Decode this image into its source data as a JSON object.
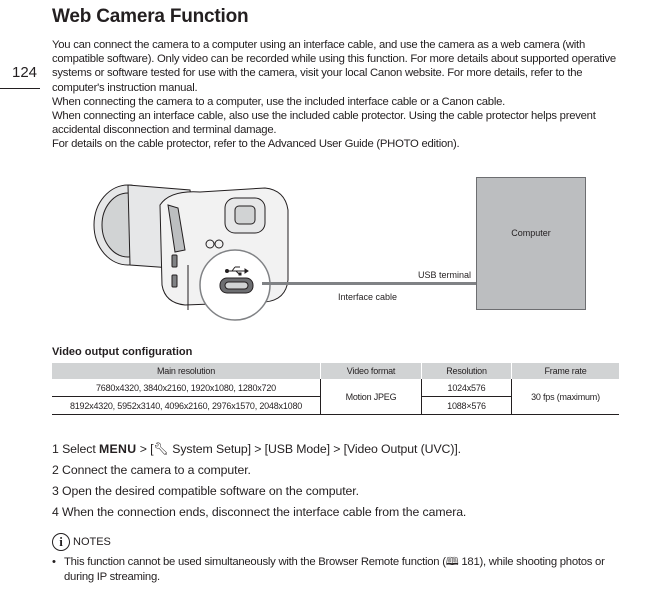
{
  "page": {
    "title": "Web Camera Function",
    "page_number": "124",
    "intro_paragraphs": [
      "You can connect the camera to a computer using an interface cable, and use the camera as a web camera (with compatible software). Only video can be recorded while using this function. For more details about supported operative systems or software tested for use with the camera, visit your local Canon website. For more details, refer to the computer's instruction manual.",
      "When connecting the camera to a computer, use the included interface cable or a Canon cable.",
      "When connecting an interface cable, also use the included cable protector. Using the cable protector helps prevent accidental disconnection and terminal damage.",
      "For details on the cable protector, refer to the Advanced User Guide (PHOTO edition)."
    ]
  },
  "figure": {
    "computer_label": "Computer",
    "usb_terminal_label": "USB terminal",
    "cable_label": "Interface cable",
    "usb_symbol": "usb-icon"
  },
  "table": {
    "title": "Video output configuration",
    "headers": [
      "Main resolution",
      "Video format",
      "Resolution",
      "Frame rate"
    ],
    "rows": [
      {
        "main_resolution": "7680x4320, 3840x2160, 1920x1080, 1280x720",
        "resolution": "1024x576"
      },
      {
        "main_resolution": "8192x4320, 5952x3140, 4096x2160, 2976x1570, 2048x1080",
        "resolution": "1088×576"
      }
    ],
    "video_format": "Motion JPEG",
    "frame_rate": "30 fps (maximum)"
  },
  "steps": {
    "s1_num": "1",
    "s1_pre": "Select",
    "s1_menu": "MENU",
    "s1_post1": "> [",
    "s1_icon": "wrench-icon",
    "s1_post2": "System Setup] > [USB Mode] > [Video Output (UVC)].",
    "s2": "2 Connect the camera to a computer.",
    "s3": "3 Open the desired compatible software on the computer.",
    "s4": "4 When the connection ends, disconnect the interface cable from the camera."
  },
  "notes": {
    "heading": "NOTES",
    "item1_pre": "This function cannot be used simultaneously with the Browser Remote function (",
    "item1_ref": "181",
    "item1_post": "), while shooting photos or during IP streaming."
  }
}
